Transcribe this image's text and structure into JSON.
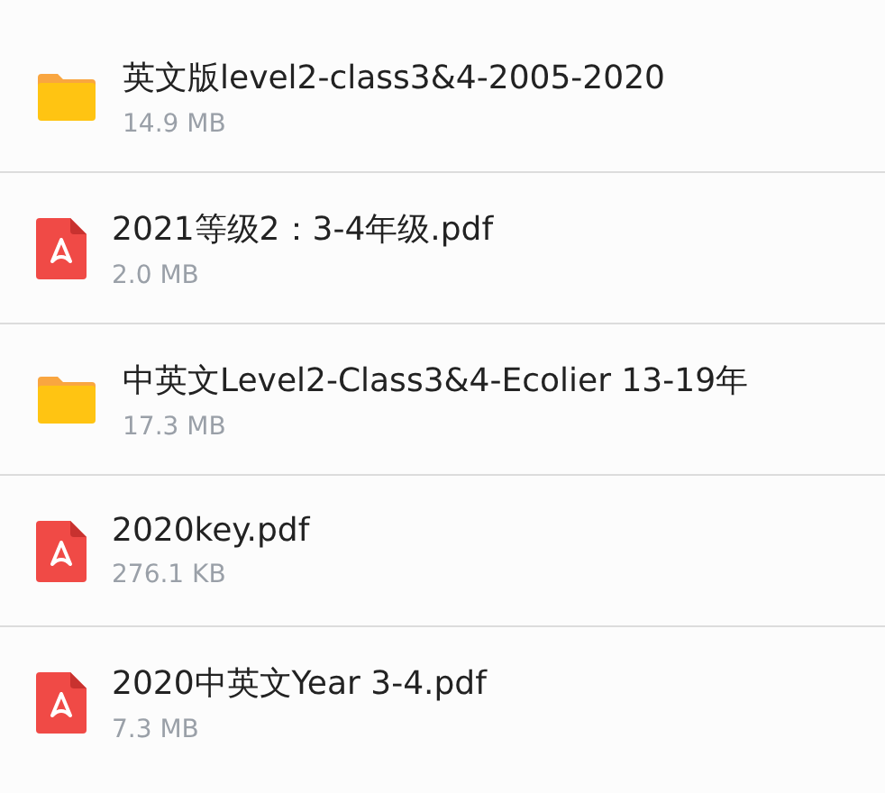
{
  "files": [
    {
      "kind": "folder",
      "name": "英文版level2-class3&4-2005-2020",
      "size": "14.9 MB"
    },
    {
      "kind": "pdf",
      "name": "2021等级2：3-4年级.pdf",
      "size": "2.0 MB"
    },
    {
      "kind": "folder",
      "name": "中英文Level2-Class3&4-Ecolier 13-19年",
      "size": "17.3 MB"
    },
    {
      "kind": "pdf",
      "name": "2020key.pdf",
      "size": "276.1 KB"
    },
    {
      "kind": "pdf",
      "name": "2020中英文Year 3-4.pdf",
      "size": "7.3 MB"
    }
  ]
}
